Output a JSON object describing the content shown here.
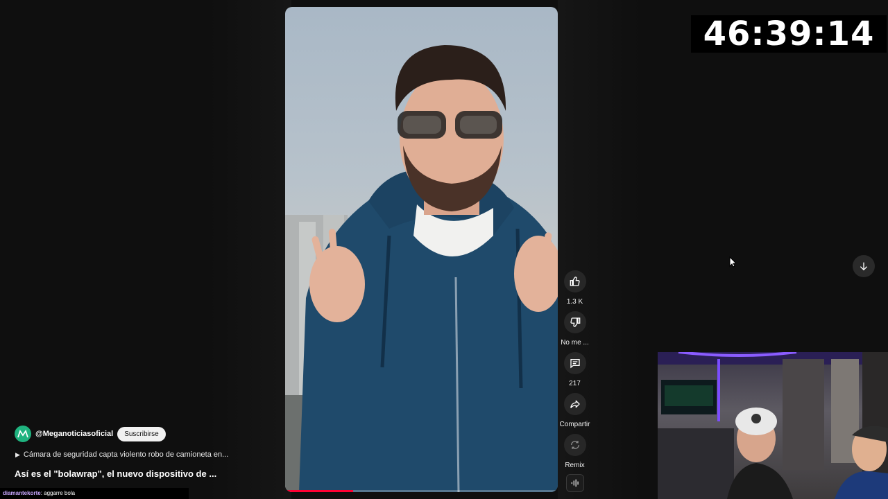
{
  "timer": "46:39:14",
  "channel": {
    "handle": "@Meganoticiasoficial",
    "subscribe_label": "Suscribirse",
    "avatar_icon": "meganoticias-logo-icon"
  },
  "playlist_text": "Cámara de seguridad capta violento robo de camioneta en...",
  "video_title": "Así es el \"bolawrap\", el nuevo dispositivo de ...",
  "actions": {
    "like_count": "1.3 K",
    "dislike_label": "No me ...",
    "comments_count": "217",
    "share_label": "Compartir",
    "remix_label": "Remix"
  },
  "chat": {
    "user": "diamantekorte",
    "message": ": aggarre bola"
  },
  "progress_fraction": 0.25,
  "colors": {
    "background": "#0f0f0f",
    "progress": "#ff0033",
    "avatar": "#1fb37f",
    "chat_user": "#c9a7ff"
  }
}
